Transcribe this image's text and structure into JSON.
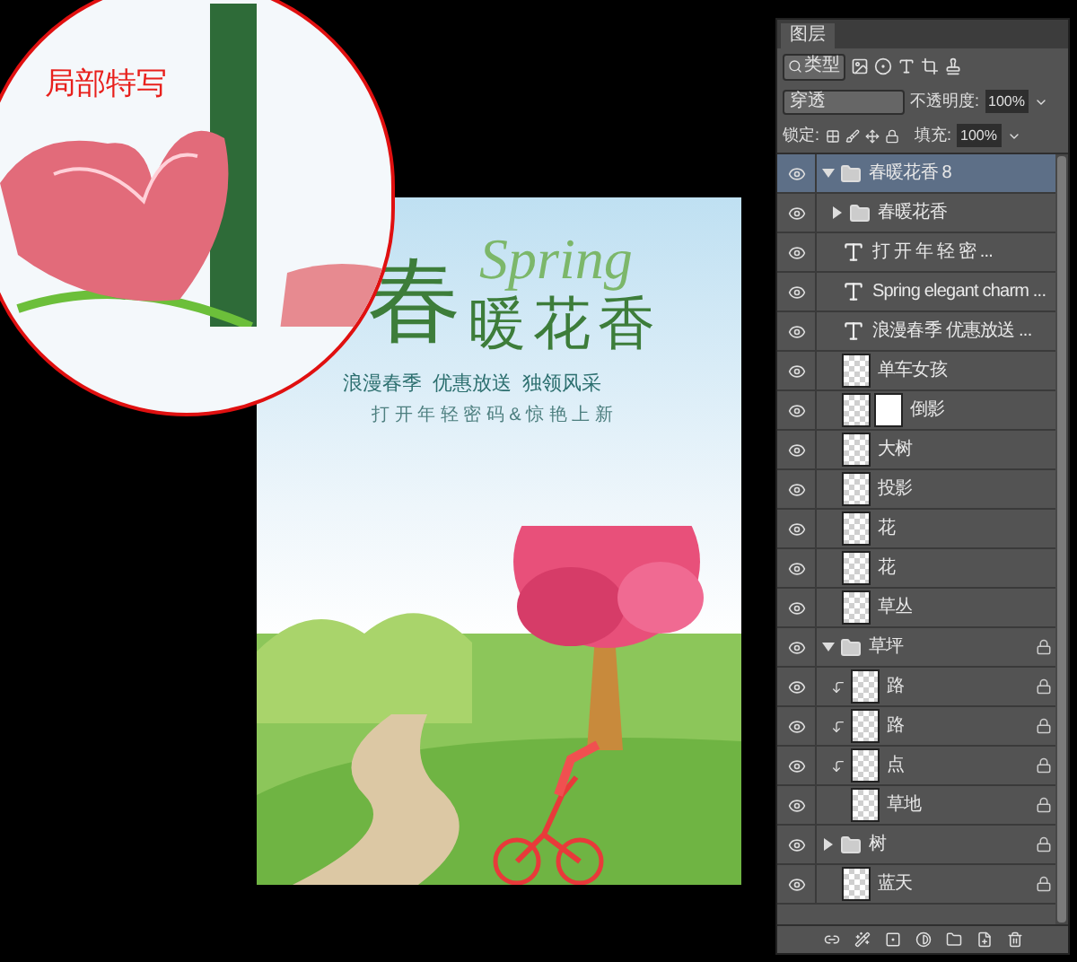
{
  "magnifier": {
    "label": "局部特写"
  },
  "poster": {
    "title_char": "春",
    "script": "Spring",
    "title_rest": "暖花香",
    "slogan": "浪漫春季  优惠放送  独领风采",
    "tagline": "打 开 年 轻 密 码 & 惊 艳 上 新"
  },
  "layers_panel": {
    "tab": "图层",
    "filter": "类型",
    "blend_mode": "穿透",
    "opacity_label": "不透明度:",
    "opacity": "100%",
    "lock_label": "锁定:",
    "fill_label": "填充:",
    "fill": "100%",
    "layers": [
      {
        "kind": "group",
        "name": "春暖花香 8",
        "visible": true,
        "selected": true,
        "expanded": true,
        "locked": false,
        "children": [
          {
            "kind": "group",
            "name": "春暖花香",
            "visible": true,
            "selected": false,
            "expanded": false,
            "locked": false
          },
          {
            "kind": "text",
            "name": "打 开 年 轻 密 ...",
            "visible": true,
            "selected": false,
            "locked": false
          },
          {
            "kind": "text",
            "name": "Spring elegant charm ...",
            "visible": true,
            "selected": false,
            "locked": false
          },
          {
            "kind": "text",
            "name": "浪漫春季 优惠放送 ...",
            "visible": true,
            "selected": false,
            "locked": false
          }
        ]
      },
      {
        "kind": "pixel",
        "name": "单车女孩",
        "visible": true,
        "selected": false,
        "locked": false,
        "clipped": false,
        "mask": false
      },
      {
        "kind": "pixel",
        "name": "倒影",
        "visible": true,
        "selected": false,
        "locked": false,
        "clipped": false,
        "mask": true
      },
      {
        "kind": "pixel",
        "name": "大树",
        "visible": true,
        "selected": false,
        "locked": false,
        "clipped": false,
        "mask": false
      },
      {
        "kind": "pixel",
        "name": "投影",
        "visible": true,
        "selected": false,
        "locked": false,
        "clipped": false,
        "mask": false
      },
      {
        "kind": "pixel",
        "name": "花",
        "visible": true,
        "selected": false,
        "locked": false,
        "clipped": false,
        "mask": false
      },
      {
        "kind": "pixel",
        "name": "花",
        "visible": true,
        "selected": false,
        "locked": false,
        "clipped": false,
        "mask": false
      },
      {
        "kind": "pixel",
        "name": "草丛",
        "visible": true,
        "selected": false,
        "locked": false,
        "clipped": false,
        "mask": false
      },
      {
        "kind": "group",
        "name": "草坪",
        "visible": true,
        "selected": false,
        "expanded": true,
        "locked": true,
        "children": [
          {
            "kind": "pixel",
            "name": "路",
            "visible": true,
            "selected": false,
            "locked": true,
            "clipped": true,
            "mask": false
          },
          {
            "kind": "pixel",
            "name": "路",
            "visible": true,
            "selected": false,
            "locked": true,
            "clipped": true,
            "mask": false
          },
          {
            "kind": "pixel",
            "name": "点",
            "visible": true,
            "selected": false,
            "locked": true,
            "clipped": true,
            "mask": false
          },
          {
            "kind": "pixel",
            "name": "草地",
            "visible": true,
            "selected": false,
            "locked": true,
            "clipped": false,
            "mask": false
          }
        ]
      },
      {
        "kind": "group",
        "name": "树",
        "visible": true,
        "selected": false,
        "expanded": false,
        "locked": true
      },
      {
        "kind": "pixel",
        "name": "蓝天",
        "visible": true,
        "selected": false,
        "locked": true,
        "clipped": false,
        "mask": false
      }
    ]
  }
}
